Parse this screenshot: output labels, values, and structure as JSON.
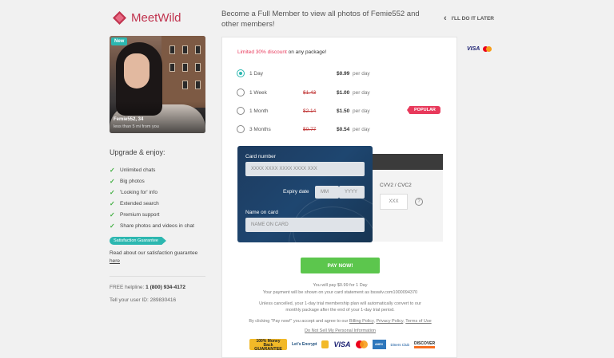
{
  "brand": {
    "logo_text": "MeetWild",
    "logo_color": "#c0334e"
  },
  "profile": {
    "badge": "New",
    "name": "Femie552, 34",
    "distance": "less than 5 mi from you"
  },
  "upgrade": {
    "title": "Upgrade & enjoy:",
    "features": [
      "Unlimited chats",
      "Big photos",
      "'Looking for' info",
      "Extended search",
      "Premium support",
      "Share photos and videos in chat"
    ]
  },
  "guarantee": {
    "badge": "Satisfaction Guarantee",
    "text": "Read about our satisfaction guarantee",
    "link": "here"
  },
  "helpline": {
    "label": "FREE helpline:",
    "number": "1 (800) 934-4172"
  },
  "userid": {
    "label": "Tell your user ID:",
    "value": "289830416"
  },
  "header": {
    "title": "Become a Full Member to view all photos of Femie552 and other members!",
    "later": "I'LL DO IT LATER"
  },
  "offer": {
    "prefix": "Limited",
    "discount": "30% discount",
    "suffix": "on any package!"
  },
  "plans": [
    {
      "label": "1 Day",
      "old": "",
      "price": "$0.99",
      "per": "per day",
      "selected": true
    },
    {
      "label": "1 Week",
      "old": "$1.43",
      "price": "$1.00",
      "per": "per day",
      "selected": false
    },
    {
      "label": "1 Month",
      "old": "$2.14",
      "price": "$1.50",
      "per": "per day",
      "selected": false
    },
    {
      "label": "3 Months",
      "old": "$0.77",
      "price": "$0.54",
      "per": "per day",
      "selected": false
    }
  ],
  "popular_label": "POPULAR",
  "card": {
    "number_label": "Card number",
    "number_placeholder": "XXXX XXXX XXXX XXXX XXX",
    "expiry_label": "Expiry date",
    "mm_placeholder": "MM",
    "yyyy_placeholder": "YYYY",
    "name_label": "Name on card",
    "name_placeholder": "NAME ON CARD",
    "cvv_label": "CVV2 / CVC2",
    "cvv_placeholder": "XXX",
    "help_icon": "?"
  },
  "pay_button": "PAY NOW!",
  "fine_print": {
    "will_pay": "You will pay $0.99 for 1 Day",
    "statement": "Your payment will be shown on your card statement as bsswlv.com1000094370",
    "renewal": "Unless cancelled, your 1-day trial membership plan will automatically convert to our monthly package after the end of your 1-day trial period.",
    "agree_prefix": "By clicking \"Pay now!\" you accept and agree to our",
    "billing": "Billing Policy",
    "privacy": "Privacy Policy",
    "terms": "Terms of Use",
    "do_not_sell": "Do Not Sell My Personal Information"
  },
  "badges": {
    "guarantee_top": "100% Money Back",
    "guarantee_main": "GUARANTEE",
    "letsencrypt": "Let's Encrypt",
    "visa": "VISA",
    "amex": "AMEX",
    "diners": "Diners Club",
    "discover": "DISCOVER"
  },
  "right_brands": {
    "visa": "VISA"
  },
  "colors": {
    "accent": "#2cb7b0",
    "pink": "#e8395b",
    "pay_green": "#5cc64d",
    "card_navy": "#1e4670"
  }
}
